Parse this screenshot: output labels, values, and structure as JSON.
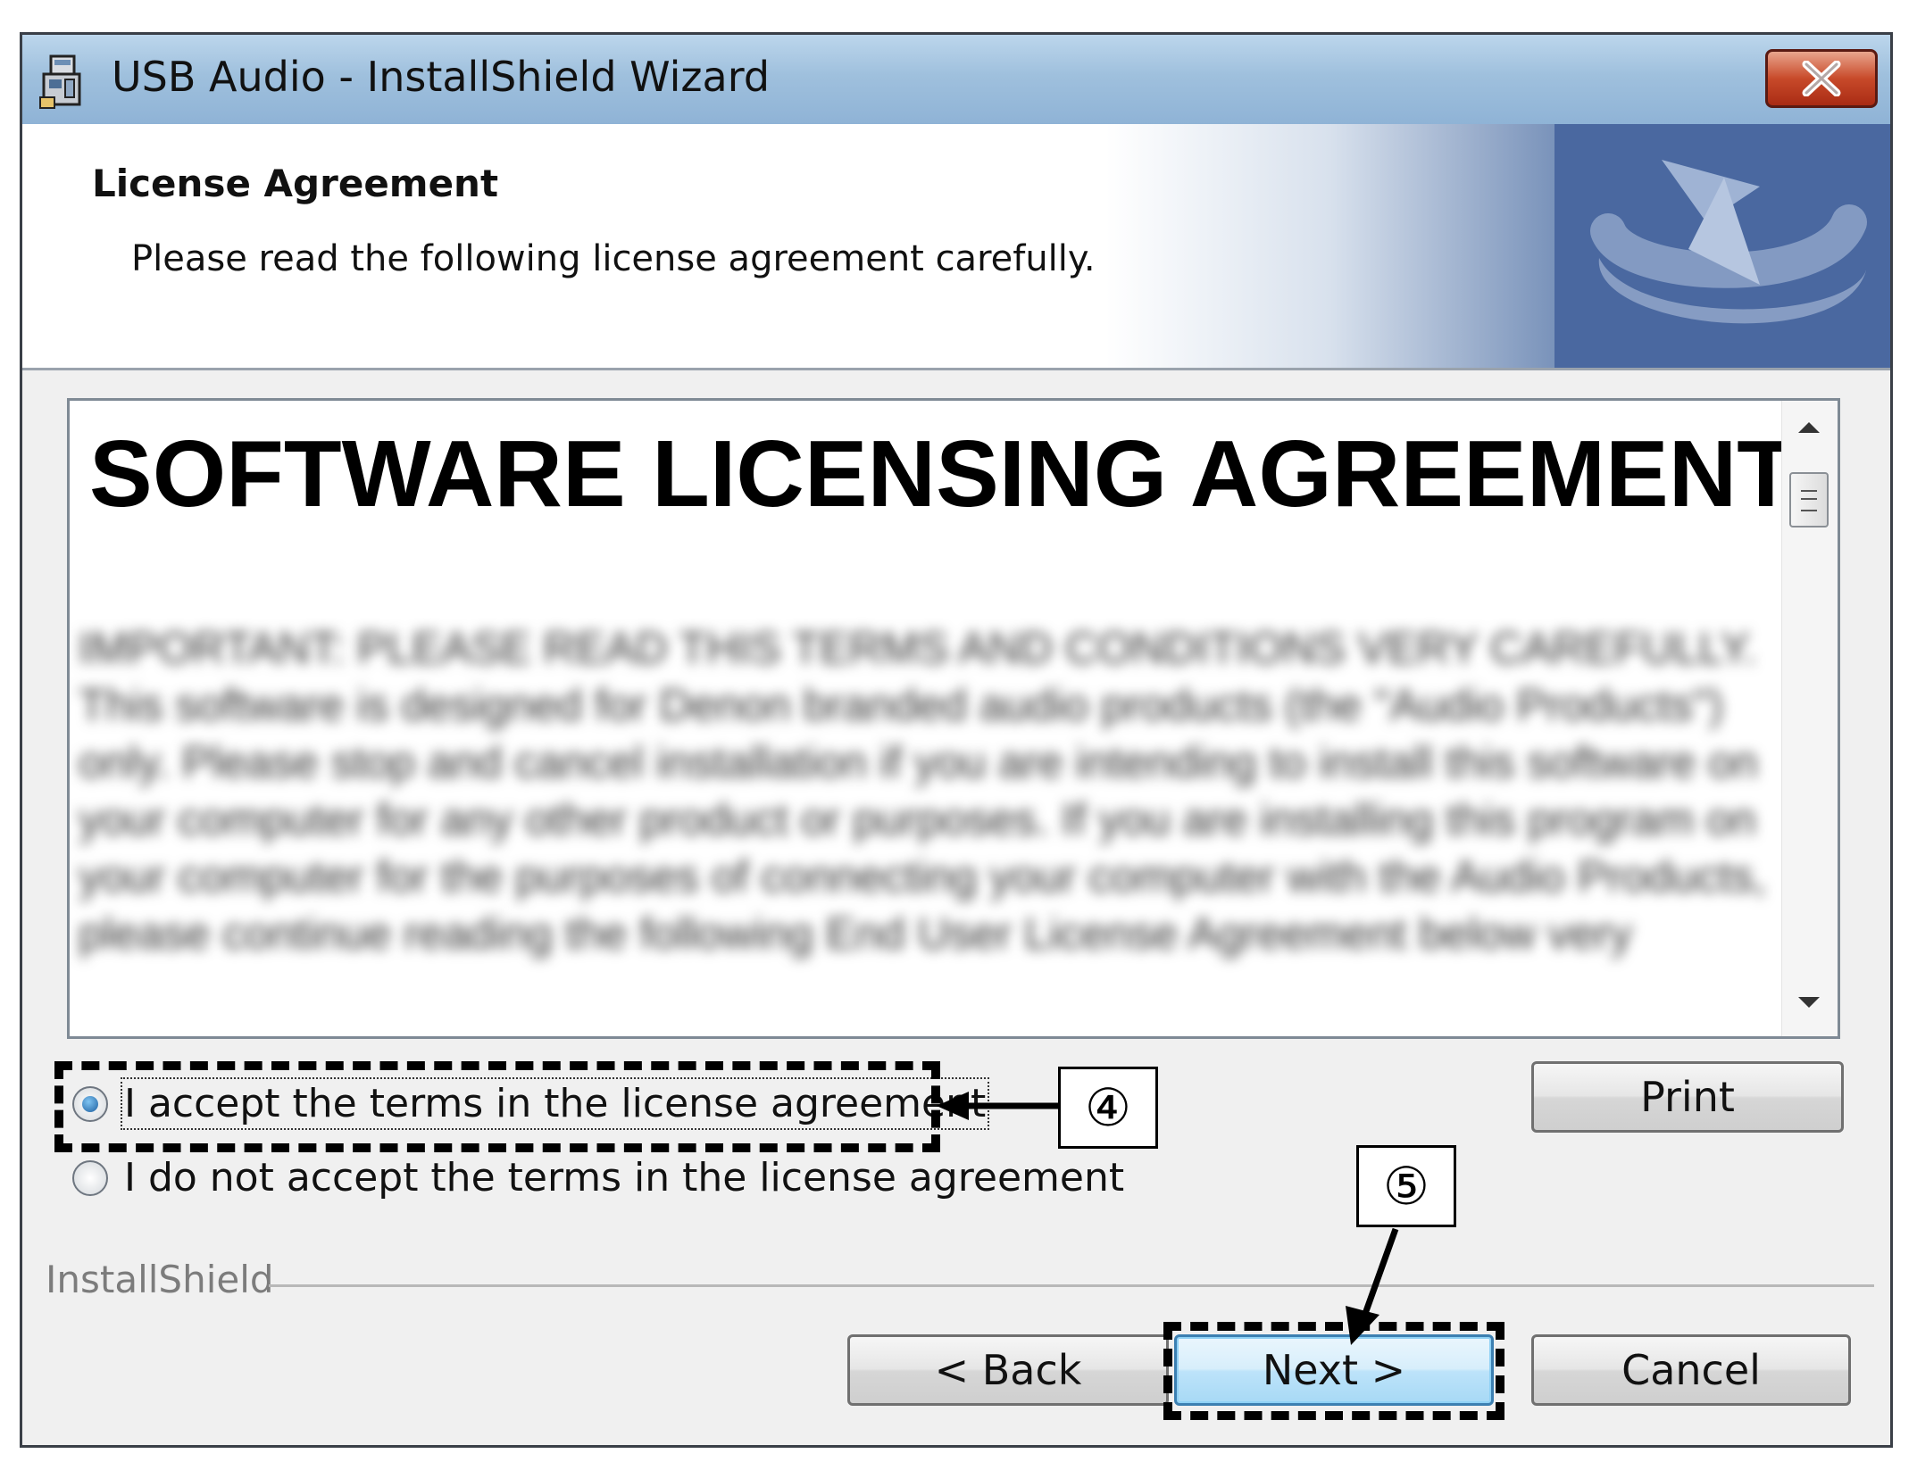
{
  "window": {
    "title": "USB Audio - InstallShield Wizard",
    "close_icon": "close-x-icon"
  },
  "header": {
    "title": "License Agreement",
    "subtitle": "Please read the following license agreement carefully."
  },
  "license": {
    "heading": "SOFTWARE LICENSING AGREEMENT",
    "body": "IMPORTANT: PLEASE READ THIS TERMS AND CONDITIONS VERY CAREFULLY. This software is designed for Denon branded audio products (the \"Audio Products\") only. Please stop and cancel installation if you are intending to install this software on your computer for any other product or purposes. If you are installing this program on your computer for the purposes of connecting your computer with the Audio Products, please continue reading the following End User License Agreement below very"
  },
  "options": {
    "accept_label": "I accept the terms in the license agreement",
    "decline_label": "I do not accept the terms in the license agreement",
    "selected": "accept"
  },
  "buttons": {
    "print": "Print",
    "back": "< Back",
    "next": "Next >",
    "cancel": "Cancel"
  },
  "footer": {
    "brand": "InstallShield"
  },
  "callouts": {
    "step4": "④",
    "step5": "⑤"
  },
  "colors": {
    "titlebar": "#9fc0dd",
    "close_button": "#c84a2a",
    "header_logo": "#41609a",
    "primary_button": "#bde3fa"
  }
}
